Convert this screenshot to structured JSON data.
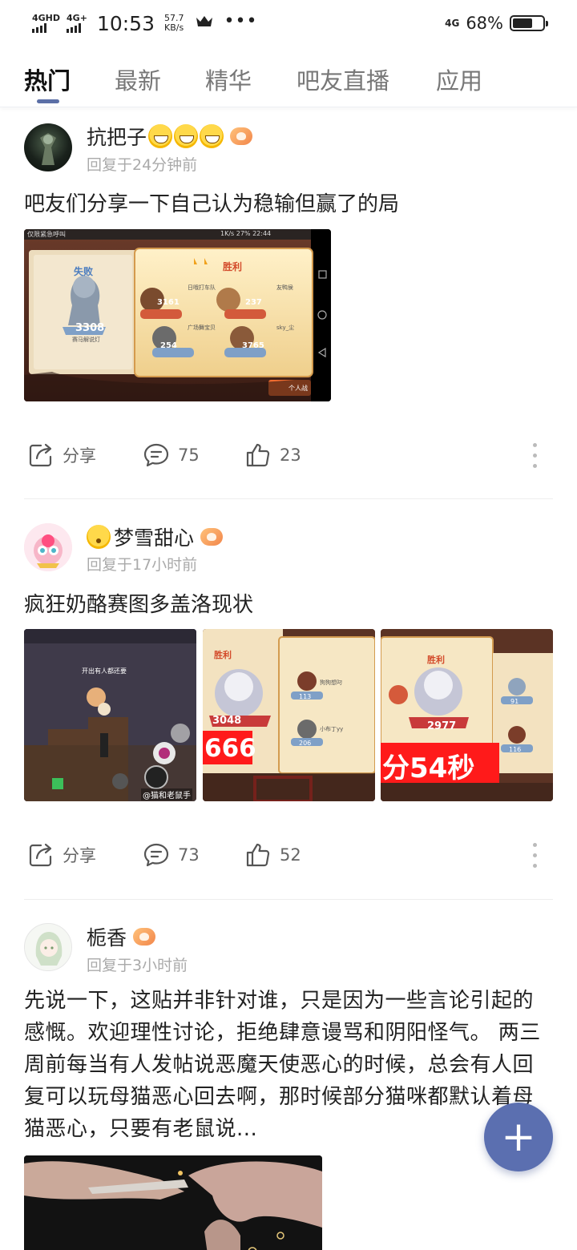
{
  "status_bar": {
    "net1": "4GHD",
    "net2": "4G+",
    "time": "10:53",
    "speed_value": "57.7",
    "speed_unit": "KB/s",
    "more": "•••",
    "net_right": "4G",
    "battery_pct": "68%",
    "battery_level": 0.68
  },
  "tabs": [
    {
      "label": "热门",
      "active": true
    },
    {
      "label": "最新"
    },
    {
      "label": "精华"
    },
    {
      "label": "吧友直播"
    },
    {
      "label": "应用"
    }
  ],
  "posts": [
    {
      "username": "抗把子",
      "reply_time": "回复于24分钟前",
      "title": "吧友们分享一下自己认为稳输但赢了的局",
      "image_texts": {
        "status_left": "仅限紧急呼叫",
        "status_right": "1K/s  27%  22:44",
        "lose": "失败",
        "lose_score": "3308",
        "lose_name": "赛马解说灯",
        "win": "胜利",
        "scores": [
          "3161",
          "237",
          "254",
          "3765"
        ],
        "names": [
          "日哦打车队",
          "友鸭侯",
          "广场舞宝贝",
          "sky_尘"
        ],
        "corner": "个人战"
      },
      "share": "分享",
      "comments": "75",
      "likes": "23"
    },
    {
      "username": "梦雪甜心",
      "reply_time": "回复于17小时前",
      "title": "疯狂奶酪赛图多盖洛现状",
      "image_texts": {
        "img1_tag": "@猫和老鼠手",
        "img1_top": "开出有人都还要",
        "img2_score": "3048",
        "img2_red": "666",
        "img2_win": "胜利",
        "img2_s1": "113",
        "img2_s2": "206",
        "img2_n1": "狗狗想叼",
        "img2_n2": "小布丁yy",
        "img3_win": "胜利",
        "img3_score": "2977",
        "img3_red": "分54秒",
        "img3_s1": "91",
        "img3_s2": "116"
      },
      "share": "分享",
      "comments": "73",
      "likes": "52"
    },
    {
      "username": "栀香",
      "reply_time": "回复于3小时前",
      "body": "先说一下，这贴并非针对谁，只是因为一些言论引起的感慨。欢迎理性讨论，拒绝肆意谩骂和阴阳怪气。 两三周前每当有人发帖说恶魔天使恶心的时候，总会有人回复可以玩母猫恶心回去啊，那时候部分猫咪都默认着母猫恶心，只要有老鼠说..."
    }
  ],
  "fab": "+",
  "colors": {
    "accent": "#5b6fb0",
    "tab_indicator": "#5b6fa6",
    "muted_text": "#aaaaaa"
  }
}
